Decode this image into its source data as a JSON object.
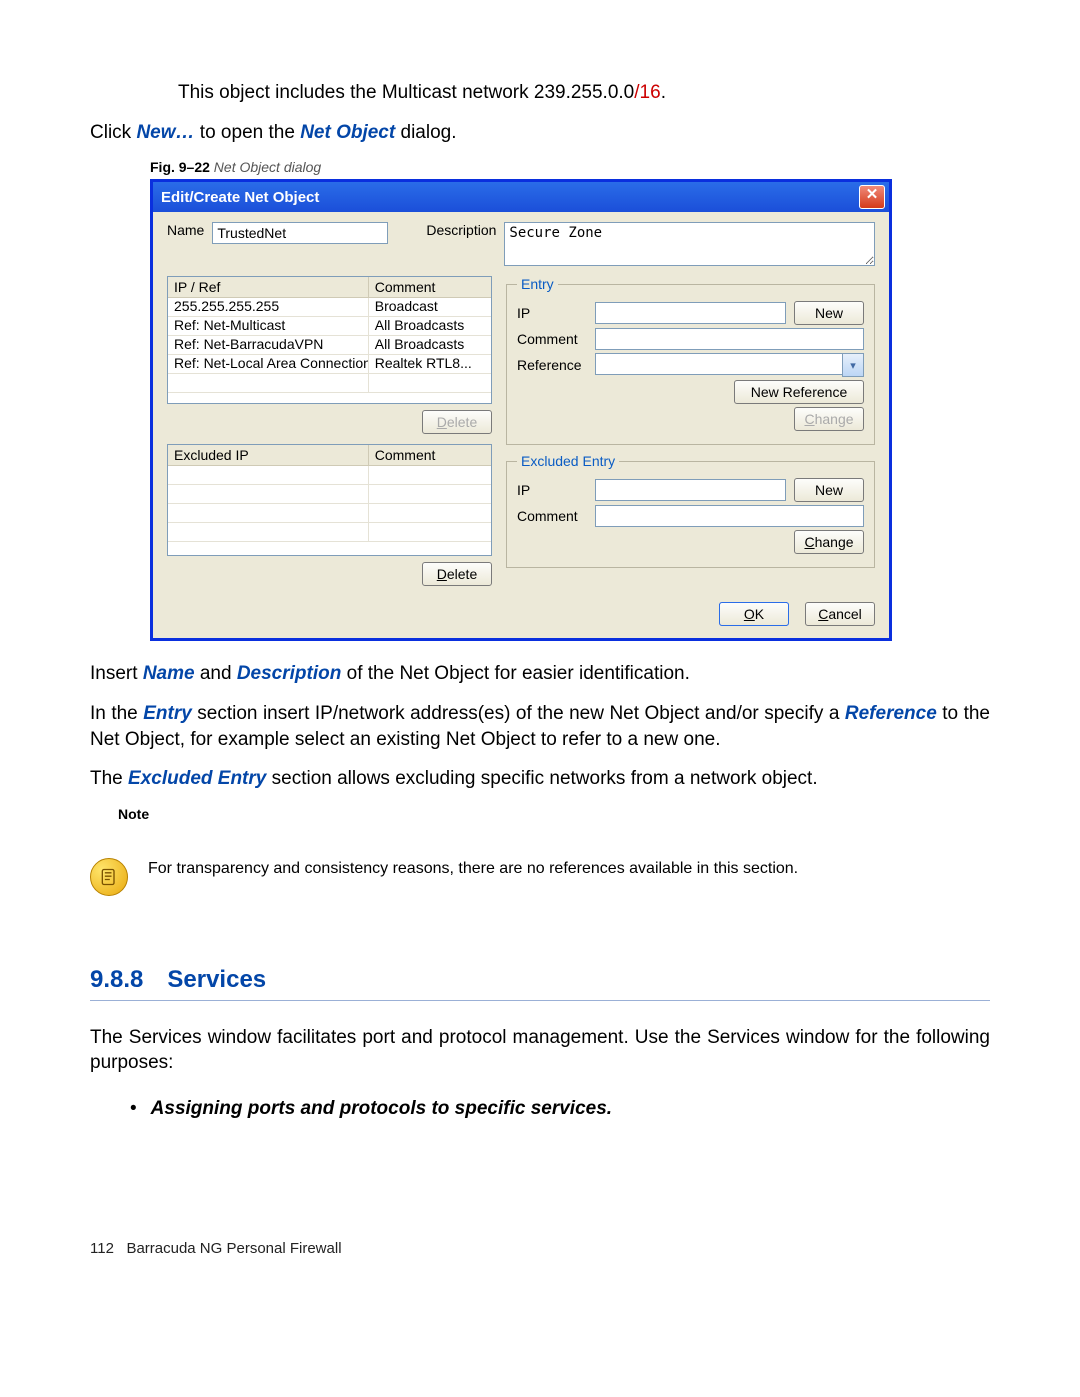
{
  "intro_line1_a": "This object includes the Multicast network 239.255.0.0",
  "intro_line1_b": "/16",
  "intro_line1_c": ".",
  "intro_line2_a": "Click ",
  "intro_line2_b": "New…",
  "intro_line2_c": " to open the ",
  "intro_line2_d": "Net Object",
  "intro_line2_e": " dialog.",
  "fig_caption_b": "Fig. 9–22",
  "fig_caption_i": " Net Object dialog",
  "dialog": {
    "title": "Edit/Create Net Object",
    "name_label": "Name",
    "name_value": "TrustedNet",
    "desc_label": "Description",
    "desc_value": "Secure Zone",
    "grid1": {
      "h1": "IP / Ref",
      "h2": "Comment",
      "rows": [
        {
          "a": "255.255.255.255",
          "b": "Broadcast"
        },
        {
          "a": "Ref: Net-Multicast",
          "b": "All Broadcasts"
        },
        {
          "a": "Ref: Net-BarracudaVPN",
          "b": "All Broadcasts"
        },
        {
          "a": "Ref: Net-Local Area Connection",
          "b": "Realtek RTL8..."
        }
      ]
    },
    "delete": "Delete",
    "grid2": {
      "h1": "Excluded IP",
      "h2": "Comment"
    },
    "entry": {
      "legend": "Entry",
      "ip": "IP",
      "comment": "Comment",
      "reference": "Reference",
      "new": "New",
      "new_reference": "New Reference",
      "change": "Change"
    },
    "excluded": {
      "legend": "Excluded Entry",
      "ip": "IP",
      "comment": "Comment",
      "new": "New",
      "change": "Change"
    },
    "ok": "OK",
    "cancel": "Cancel"
  },
  "p_after1_a": "Insert ",
  "p_after1_b": "Name",
  "p_after1_c": " and ",
  "p_after1_d": "Description",
  "p_after1_e": " of the Net Object for easier identification.",
  "p_after2_a": "In the ",
  "p_after2_b": "Entry",
  "p_after2_c": " section insert IP/network address(es) of the new Net Object and/or specify a ",
  "p_after2_d": "Reference",
  "p_after2_e": " to the Net Object, for example select an existing Net Object to refer to a new one.",
  "p_after3_a": "The ",
  "p_after3_b": "Excluded Entry",
  "p_after3_c": " section allows excluding specific networks from a network object.",
  "note_label": "Note",
  "note_text": "For transparency and consistency reasons, there are no references available in this section.",
  "section_num": "9.8.8",
  "section_title": "Services",
  "services_para": "The Services window facilitates port and protocol management. Use the Services window for the following purposes:",
  "bullet1": "Assigning ports and protocols to specific services.",
  "footer_page": "112",
  "footer_text": "Barracuda NG Personal Firewall"
}
